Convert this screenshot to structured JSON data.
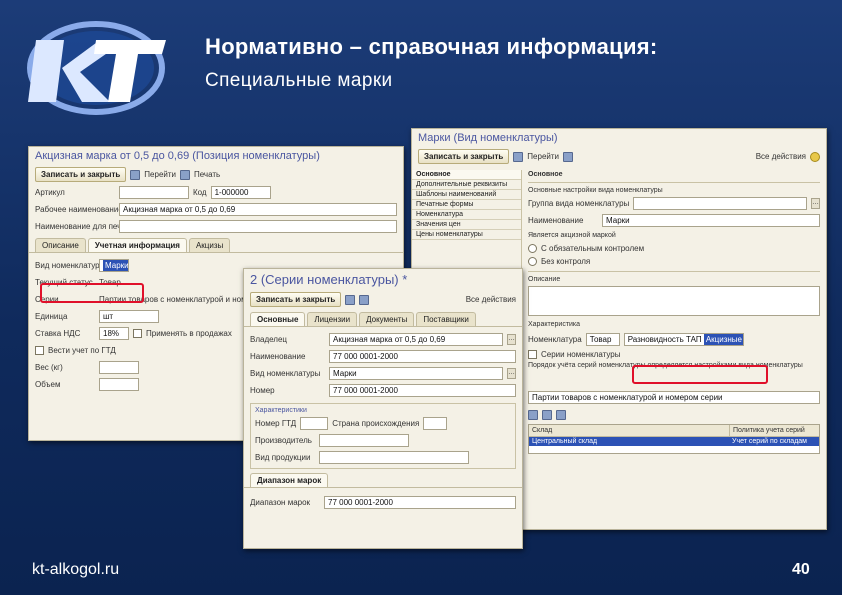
{
  "slide": {
    "title": "Нормативно – справочная информация:",
    "subtitle": "Специальные  марки",
    "site": "kt-alkogol.ru",
    "page": "40",
    "logo_text": "KT"
  },
  "win_right": {
    "title": "Марки (Вид номенклатуры)",
    "save_close": "Записать и закрыть",
    "actions": "Перейти",
    "more": "Все действия",
    "nav": [
      "Основное",
      "Дополнительные реквизиты",
      "Шаблоны наименований",
      "Печатные формы",
      "Номенклатура",
      "Значения цен",
      "Цены номенклатуры"
    ],
    "nav_header": "Основное",
    "text1": "Основные настройки вида номенклатуры",
    "text2": "Группа вида номенклатуры",
    "name_label": "Наименование",
    "name_value": "Марки",
    "text3": "Является акцизной маркой",
    "radio1": "С обязательным контролем",
    "radio2": "Без контроля",
    "description_label": "Описание",
    "section2": "Характеристика",
    "nomen_label": "Номенклатура",
    "nomen_value": "Товар",
    "char_value": "Разновидность ТАП",
    "char_selected": "Акцизные марки",
    "series_label": "Серии номенклатуры",
    "series_text": "Порядок учёта серий номенклатуры определяется настройками вида номенклатуры",
    "series_value": "Партии товаров с номенклатурой и номером серии",
    "table_col1": "Склад",
    "table_col2": "Политика учета серий",
    "table_row_col1": "Центральный склад",
    "table_row_col2": "Учет серий по складам"
  },
  "win_left": {
    "title": "Акцизная марка от 0,5 до 0,69 (Позиция номенклатуры)",
    "save_close": "Записать и закрыть",
    "actions": "Перейти",
    "more": "Печать",
    "rows": [
      {
        "label": "Артикул",
        "value": "",
        "label2": "Код",
        "value2": "1-000000"
      },
      {
        "label": "Рабочее наименование",
        "value": "Акцизная марка от 0,5 до 0,69"
      },
      {
        "label": "Наименование для печати",
        "value": ""
      }
    ],
    "tabs": [
      "Описание",
      "Учетная информация",
      "Акцизы"
    ],
    "kind_label": "Вид номенклатуры",
    "kind_value": "Марки",
    "tax_label": "Текущий статус",
    "tax_value": "Товар",
    "series_label": "Серии",
    "series_value": "Партии товаров с номенклатурой и номером",
    "unit_label": "Единица",
    "unit_value": "шт",
    "rate_label": "Ставка НДС",
    "rate_value": "18%",
    "rate_extra": "Применять в продажах",
    "gtd_label": "Вести учет по ГТД",
    "weight_label": "Вес (кг)",
    "volume_label": "Объем"
  },
  "win_mid": {
    "title": "2 (Серии номенклатуры) *",
    "save_close": "Записать и закрыть",
    "more": "Все действия",
    "tabs": [
      "Основные",
      "Лицензии",
      "Документы",
      "Поставщики"
    ],
    "owner_label": "Владелец",
    "owner_value": "Акцизная марка от 0,5 до 0,69",
    "name_label": "Наименование",
    "name_value": "77 000 0001-2000",
    "kind_label": "Вид номенклатуры",
    "kind_value": "Марки",
    "num_label": "Номер",
    "num_value": "77 000 0001-2000",
    "group_title": "Характеристики",
    "gtd_label": "Номер ГТД",
    "country_label": "Страна происхождения",
    "producer_label": "Производитель",
    "prod_kind_label": "Вид продукции",
    "range_tab": "Диапазон марок",
    "range_label": "Диапазон марок",
    "range_value": "77 000 0001-2000"
  }
}
